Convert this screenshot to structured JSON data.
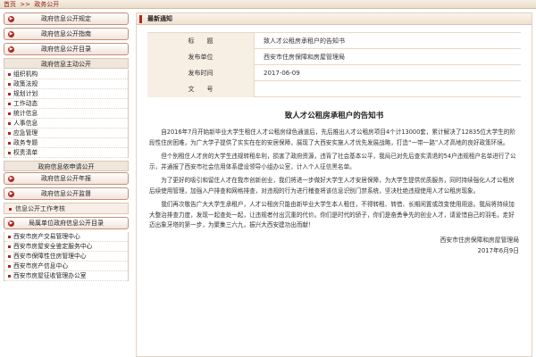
{
  "breadcrumb": {
    "home": "首页",
    "separator": ">>",
    "section": "政务公开"
  },
  "sidebar": {
    "top_buttons": [
      "政府信息公开规定",
      "政府信息公开指南",
      "政府信息公开目录"
    ],
    "group1_title": "政府信息主动公开",
    "group1_items": [
      "组织机构",
      "政策法规",
      "规划计划",
      "工作动态",
      "统计信息",
      "人事信息",
      "应急管理",
      "政务专题",
      "权责清单"
    ],
    "group2_title": "政府信息依申请公开",
    "mid_buttons": [
      "政府信息公开年报",
      "政府信息公开监督"
    ],
    "work_item": "信息公开工作考核",
    "bureau_button": "局属单位政府信息公开目录",
    "bureau_items": [
      "西安市房产交易管理中心",
      "西安市房屋安全鉴定服务中心",
      "西安市保障性住房管理中心",
      "西安市房产信息中心",
      "西安市房屋征收管理办公室"
    ]
  },
  "main": {
    "header": "最新通知",
    "meta": [
      {
        "label": "标　　题",
        "value": "致人才公租房承租户的告知书"
      },
      {
        "label": "发布单位",
        "value": "西安市住房保障和房屋管理局"
      },
      {
        "label": "发布时间",
        "value": "2017-06-09"
      },
      {
        "label": "文　　号",
        "value": ""
      }
    ],
    "doc_title": "致人才公租房承租户的告知书",
    "paragraphs": [
      "自2016年7月开始新毕业大学生租住人才公租房绿色通道后，先后推出人才公租房项目4个计13000套，累计解决了12835位大学生的阶段性住房困难，为广大学子提供了实实在在的安居保障，展现了大西安实施人才优先发展战略，打造“一带一路”人才高地的良好政策环境。",
      "但个别租住人才房的大学生违规转租牟利，损害了政府资源，违背了社会基本公平，我局已对先后查实清退的54户违规租户名单进行了公示，并通报了西安市社会信用体系建设领导小组办公室，计入个人征信黑名单。",
      "为了更好的吸引和留住人才在我市创新创业，我们将进一步做好大学生人才安居保障，为大学生提供优质服务，同时持续强化人才公租房后续使用管理，加强入户排查和网格排查，对违规的行为进行稽查将该信息识别门禁系统，坚决杜绝违规使用人才公租房现象。",
      "我们再次敬告广大大学生承租户，人才公租房只能由新毕业大学生本人租住，不得转租、转借、长期闲置或改变使用用途。我局将持续加大整治排查力度，发现一起查处一起，让违规者付出沉重的代价。你们是时代的骄子，你们是奋勇争先的创业人才，请爱惜自己的羽毛，走好迈出象牙塔的第一步，为聚集三六九，振兴大西安建功出而献！"
    ],
    "signature_org": "西安市住房保障和房屋管理局",
    "signature_date": "2017年6月9日"
  },
  "colors": {
    "accent": "#b3261e",
    "panel": "#f7eee4"
  }
}
